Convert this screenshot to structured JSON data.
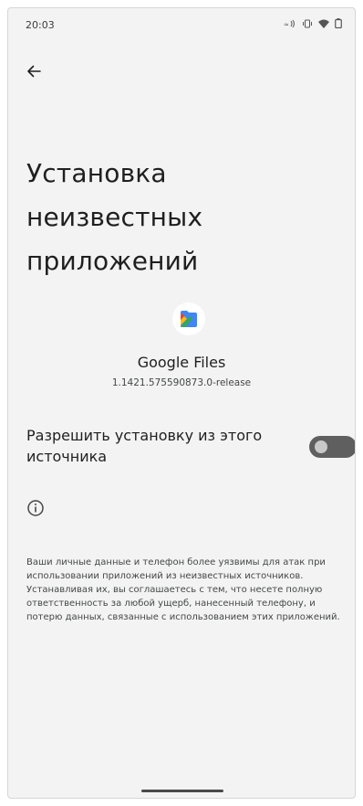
{
  "status_bar": {
    "time": "20:03",
    "icons": [
      "volte-signal-icon",
      "vibrate-icon",
      "wifi-icon",
      "battery-icon"
    ]
  },
  "navigation": {
    "back_icon": "arrow-back-icon"
  },
  "page": {
    "title": "Установка неизвестных приложений"
  },
  "app": {
    "icon": "google-files-icon",
    "name": "Google Files",
    "version": "1.1421.575590873.0-release"
  },
  "setting": {
    "label": "Разрешить установку из этого источника",
    "enabled": false
  },
  "info": {
    "icon": "info-icon",
    "text": "Ваши личные данные и телефон более уязвимы для атак при использовании приложений из неизвестных источников. Устанавливая их, вы соглашаетесь с тем, что несете полную ответственность за любой ущерб, нанесенный телефону, и потерю данных, связанные с использованием этих приложений."
  },
  "colors": {
    "background": "#f3f3f3",
    "toggle_track_off": "#5f5f5f",
    "toggle_knob_off": "#c8c8c8",
    "text_primary": "#1f1f1f",
    "text_secondary": "#444746"
  }
}
